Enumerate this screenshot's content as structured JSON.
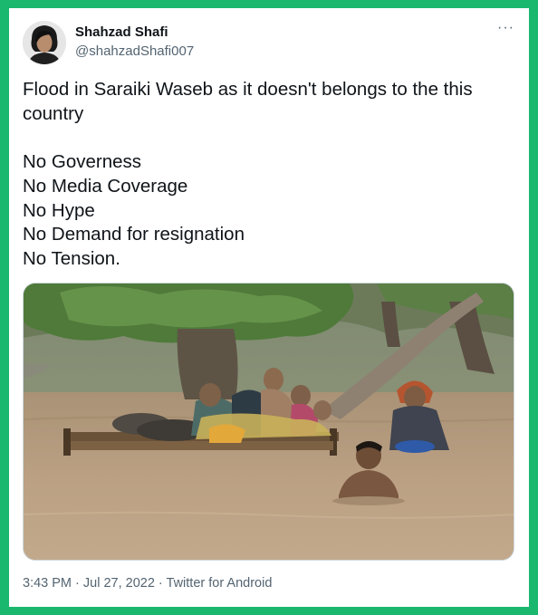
{
  "author": {
    "name": "Shahzad Shafi",
    "handle": "@shahzadShafi007"
  },
  "tweet": {
    "text": "Flood in Saraiki Waseb as it doesn't belongs to the this country\n\nNo Governess\nNo Media Coverage\nNo Hype\nNo Demand for resignation\nNo Tension."
  },
  "more_label": "···",
  "meta": {
    "time": "3:43 PM",
    "sep": " · ",
    "date": "Jul 27, 2022",
    "source": "Twitter for Android"
  },
  "colors": {
    "frame": "#19b86e",
    "text": "#0f1419",
    "secondary": "#536471",
    "water": "#b49a79"
  }
}
